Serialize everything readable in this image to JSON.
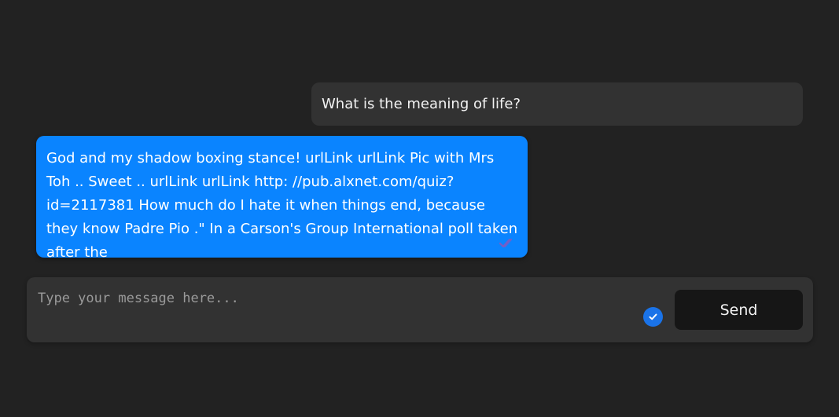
{
  "conversation": {
    "user_message": "What is the meaning of life?",
    "bot_message": "God and my shadow boxing stance! urlLink urlLink Pic with Mrs Toh .. Sweet .. urlLink urlLink http: //pub.alxnet.com/quiz? id=2117381 How much do I hate it when things end, because they know Padre Pio .\" In a Carson's Group International poll taken after the",
    "bot_message_status_icon": "double-check-icon"
  },
  "composer": {
    "placeholder": "Type your message here...",
    "value": "",
    "status_icon": "check-circle-icon",
    "send_label": "Send"
  },
  "colors": {
    "background": "#222222",
    "user_bubble": "#323232",
    "bot_bubble": "#0a84ff",
    "send_button": "#161616",
    "check_badge": "#1a73e8"
  }
}
